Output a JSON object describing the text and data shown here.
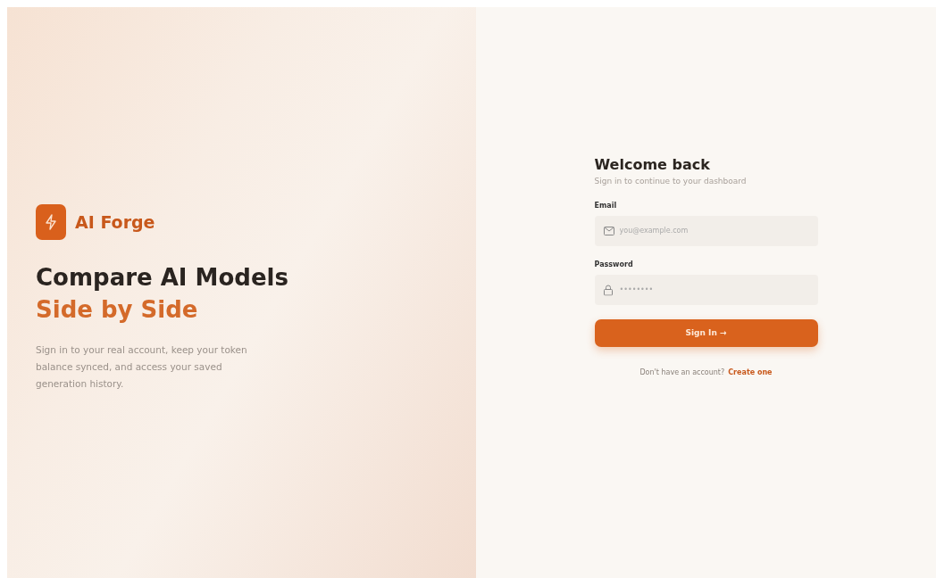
{
  "brand": {
    "name": "AI Forge"
  },
  "hero": {
    "title": "Compare AI Models",
    "highlight": "Side by Side",
    "description": "Sign in to your real account, keep your token balance synced, and access your saved generation history."
  },
  "form": {
    "title": "Welcome back",
    "subtitle": "Sign in to continue to your dashboard",
    "fields": [
      {
        "label": "Email",
        "placeholder": "you@example.com",
        "kind": "email"
      },
      {
        "label": "Password",
        "placeholder": "••••••••",
        "kind": "password"
      }
    ],
    "submit": {
      "label": "Sign In",
      "arrow": "→"
    },
    "footer": {
      "text": "Don't have an account?",
      "link": "Create one"
    }
  }
}
